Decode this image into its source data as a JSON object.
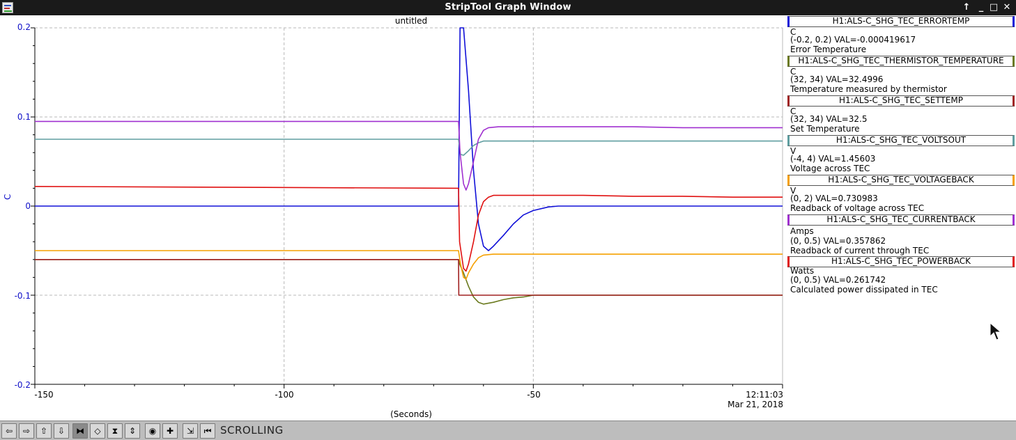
{
  "window": {
    "title": "StripTool Graph Window"
  },
  "titlebar_buttons": [
    "↑",
    "_",
    "□",
    "✕"
  ],
  "plot": {
    "title": "untitled",
    "y_axis_label": "C",
    "y_ticks": [
      "0.2",
      "0.1",
      "0",
      "-0.1",
      "-0.2"
    ],
    "x_ticks": [
      "-150",
      "-100",
      "-50"
    ],
    "x_axis_label": "(Seconds)",
    "timestamp_time": "12:11:03",
    "timestamp_date": "Mar 21, 2018"
  },
  "legend": [
    {
      "name": "H1:ALS-C_SHG_TEC_ERRORTEMP",
      "units": "C",
      "range_val": "(-0.2, 0.2) VAL=-0.000419617",
      "description": "Error Temperature",
      "color": "#1010d8"
    },
    {
      "name": "H1:ALS-C_SHG_TEC_THERMISTOR_TEMPERATURE",
      "units": "C",
      "range_val": "(32, 34) VAL=32.4996",
      "description": "Temperature measured by thermistor",
      "color": "#6b7a1e"
    },
    {
      "name": "H1:ALS-C_SHG_TEC_SETTEMP",
      "units": "C",
      "range_val": "(32, 34) VAL=32.5",
      "description": "Set Temperature",
      "color": "#a02020"
    },
    {
      "name": "H1:ALS-C_SHG_TEC_VOLTSOUT",
      "units": "V",
      "range_val": "(-4, 4) VAL=1.45603",
      "description": "Voltage across TEC",
      "color": "#5f9ea0"
    },
    {
      "name": "H1:ALS-C_SHG_TEC_VOLTAGEBACK",
      "units": "V",
      "range_val": "(0, 2) VAL=0.730983",
      "description": "Readback of voltage across TEC",
      "color": "#f5a000"
    },
    {
      "name": "H1:ALS-C_SHG_TEC_CURRENTBACK",
      "units": "Amps",
      "range_val": "(0, 0.5) VAL=0.357862",
      "description": "Readback of current through TEC",
      "color": "#a030d0"
    },
    {
      "name": "H1:ALS-C_SHG_TEC_POWERBACK",
      "units": "Watts",
      "range_val": "(0, 0.5) VAL=0.261742",
      "description": "Calculated power dissipated in TEC",
      "color": "#e01010"
    }
  ],
  "toolbar": {
    "mode_label": "SCROLLING",
    "buttons": [
      {
        "name": "pan-left-button",
        "glyph": "⇦"
      },
      {
        "name": "pan-right-button",
        "glyph": "⇨"
      },
      {
        "name": "pan-up-button",
        "glyph": "⇧"
      },
      {
        "name": "pan-down-button",
        "glyph": "⇩"
      },
      {
        "name": "zoom-in-x-button",
        "glyph": "⧓"
      },
      {
        "name": "zoom-out-x-button",
        "glyph": "◇"
      },
      {
        "name": "zoom-in-y-button",
        "glyph": "⧗"
      },
      {
        "name": "zoom-out-y-button",
        "glyph": "⇕"
      },
      {
        "name": "auto-scale-button",
        "glyph": "◉"
      },
      {
        "name": "refresh-button",
        "glyph": "✚"
      },
      {
        "name": "reset-button",
        "glyph": "⇲"
      },
      {
        "name": "jump-to-now-button",
        "glyph": "⏮"
      }
    ]
  },
  "chart_data": {
    "type": "line",
    "title": "untitled",
    "xlabel": "(Seconds)",
    "ylabel": "C",
    "xlim": [
      -150,
      0
    ],
    "ylim": [
      -0.2,
      0.2
    ],
    "grid": true,
    "series": [
      {
        "name": "H1:ALS-C_SHG_TEC_ERRORTEMP",
        "color": "#1010d8",
        "points": [
          [
            -150,
            0.0
          ],
          [
            -65,
            0.0
          ],
          [
            -64.7,
            0.2
          ],
          [
            -64,
            0.2
          ],
          [
            -63,
            0.13
          ],
          [
            -62,
            0.04
          ],
          [
            -61,
            -0.02
          ],
          [
            -60,
            -0.045
          ],
          [
            -59,
            -0.05
          ],
          [
            -58,
            -0.045
          ],
          [
            -56,
            -0.033
          ],
          [
            -54,
            -0.02
          ],
          [
            -52,
            -0.01
          ],
          [
            -50,
            -0.005
          ],
          [
            -47,
            -0.001
          ],
          [
            -45,
            0.0
          ],
          [
            -40,
            0.0
          ],
          [
            -30,
            0.0
          ],
          [
            -20,
            0.0
          ],
          [
            -10,
            0.0
          ],
          [
            0,
            0.0
          ]
        ]
      },
      {
        "name": "H1:ALS-C_SHG_TEC_THERMISTOR_TEMPERATURE",
        "color": "#6b7a1e",
        "points": [
          [
            -150,
            -0.06
          ],
          [
            -65,
            -0.06
          ],
          [
            -64.8,
            -0.065
          ],
          [
            -64,
            -0.075
          ],
          [
            -63,
            -0.09
          ],
          [
            -62,
            -0.102
          ],
          [
            -61,
            -0.108
          ],
          [
            -60,
            -0.11
          ],
          [
            -58,
            -0.108
          ],
          [
            -56,
            -0.105
          ],
          [
            -54,
            -0.103
          ],
          [
            -52,
            -0.102
          ],
          [
            -50,
            -0.1
          ],
          [
            -45,
            -0.1
          ],
          [
            -40,
            -0.1
          ],
          [
            -30,
            -0.1
          ],
          [
            0,
            -0.1
          ]
        ]
      },
      {
        "name": "H1:ALS-C_SHG_TEC_SETTEMP",
        "color": "#a02020",
        "points": [
          [
            -150,
            -0.06
          ],
          [
            -65,
            -0.06
          ],
          [
            -64.95,
            -0.1
          ],
          [
            0,
            -0.1
          ]
        ]
      },
      {
        "name": "H1:ALS-C_SHG_TEC_VOLTSOUT",
        "color": "#5f9ea0",
        "points": [
          [
            -150,
            0.075
          ],
          [
            -65,
            0.075
          ],
          [
            -64.6,
            0.058
          ],
          [
            -64,
            0.057
          ],
          [
            -63,
            0.062
          ],
          [
            -62,
            0.068
          ],
          [
            -61,
            0.071
          ],
          [
            -60,
            0.073
          ],
          [
            -58,
            0.073
          ],
          [
            -50,
            0.073
          ],
          [
            -30,
            0.073
          ],
          [
            0,
            0.073
          ]
        ]
      },
      {
        "name": "H1:ALS-C_SHG_TEC_VOLTAGEBACK",
        "color": "#f5a000",
        "points": [
          [
            -150,
            -0.05
          ],
          [
            -65,
            -0.05
          ],
          [
            -64.6,
            -0.065
          ],
          [
            -64,
            -0.08
          ],
          [
            -63.5,
            -0.082
          ],
          [
            -63,
            -0.075
          ],
          [
            -62,
            -0.065
          ],
          [
            -61,
            -0.058
          ],
          [
            -60,
            -0.055
          ],
          [
            -58,
            -0.054
          ],
          [
            -50,
            -0.054
          ],
          [
            -30,
            -0.054
          ],
          [
            0,
            -0.054
          ]
        ]
      },
      {
        "name": "H1:ALS-C_SHG_TEC_CURRENTBACK",
        "color": "#a030d0",
        "points": [
          [
            -150,
            0.095
          ],
          [
            -65,
            0.095
          ],
          [
            -64.7,
            0.06
          ],
          [
            -64,
            0.025
          ],
          [
            -63.5,
            0.018
          ],
          [
            -63,
            0.025
          ],
          [
            -62,
            0.05
          ],
          [
            -61,
            0.075
          ],
          [
            -60,
            0.085
          ],
          [
            -59,
            0.088
          ],
          [
            -57,
            0.089
          ],
          [
            -50,
            0.089
          ],
          [
            -40,
            0.089
          ],
          [
            -30,
            0.089
          ],
          [
            -20,
            0.088
          ],
          [
            -10,
            0.088
          ],
          [
            0,
            0.088
          ]
        ]
      },
      {
        "name": "H1:ALS-C_SHG_TEC_POWERBACK",
        "color": "#e01010",
        "points": [
          [
            -150,
            0.022
          ],
          [
            -65,
            0.02
          ],
          [
            -64.8,
            -0.04
          ],
          [
            -64,
            -0.07
          ],
          [
            -63.5,
            -0.073
          ],
          [
            -63,
            -0.065
          ],
          [
            -62,
            -0.04
          ],
          [
            -61,
            -0.01
          ],
          [
            -60,
            0.005
          ],
          [
            -59,
            0.01
          ],
          [
            -58,
            0.012
          ],
          [
            -50,
            0.012
          ],
          [
            -40,
            0.012
          ],
          [
            -30,
            0.011
          ],
          [
            -20,
            0.011
          ],
          [
            -10,
            0.01
          ],
          [
            0,
            0.01
          ]
        ]
      }
    ]
  }
}
